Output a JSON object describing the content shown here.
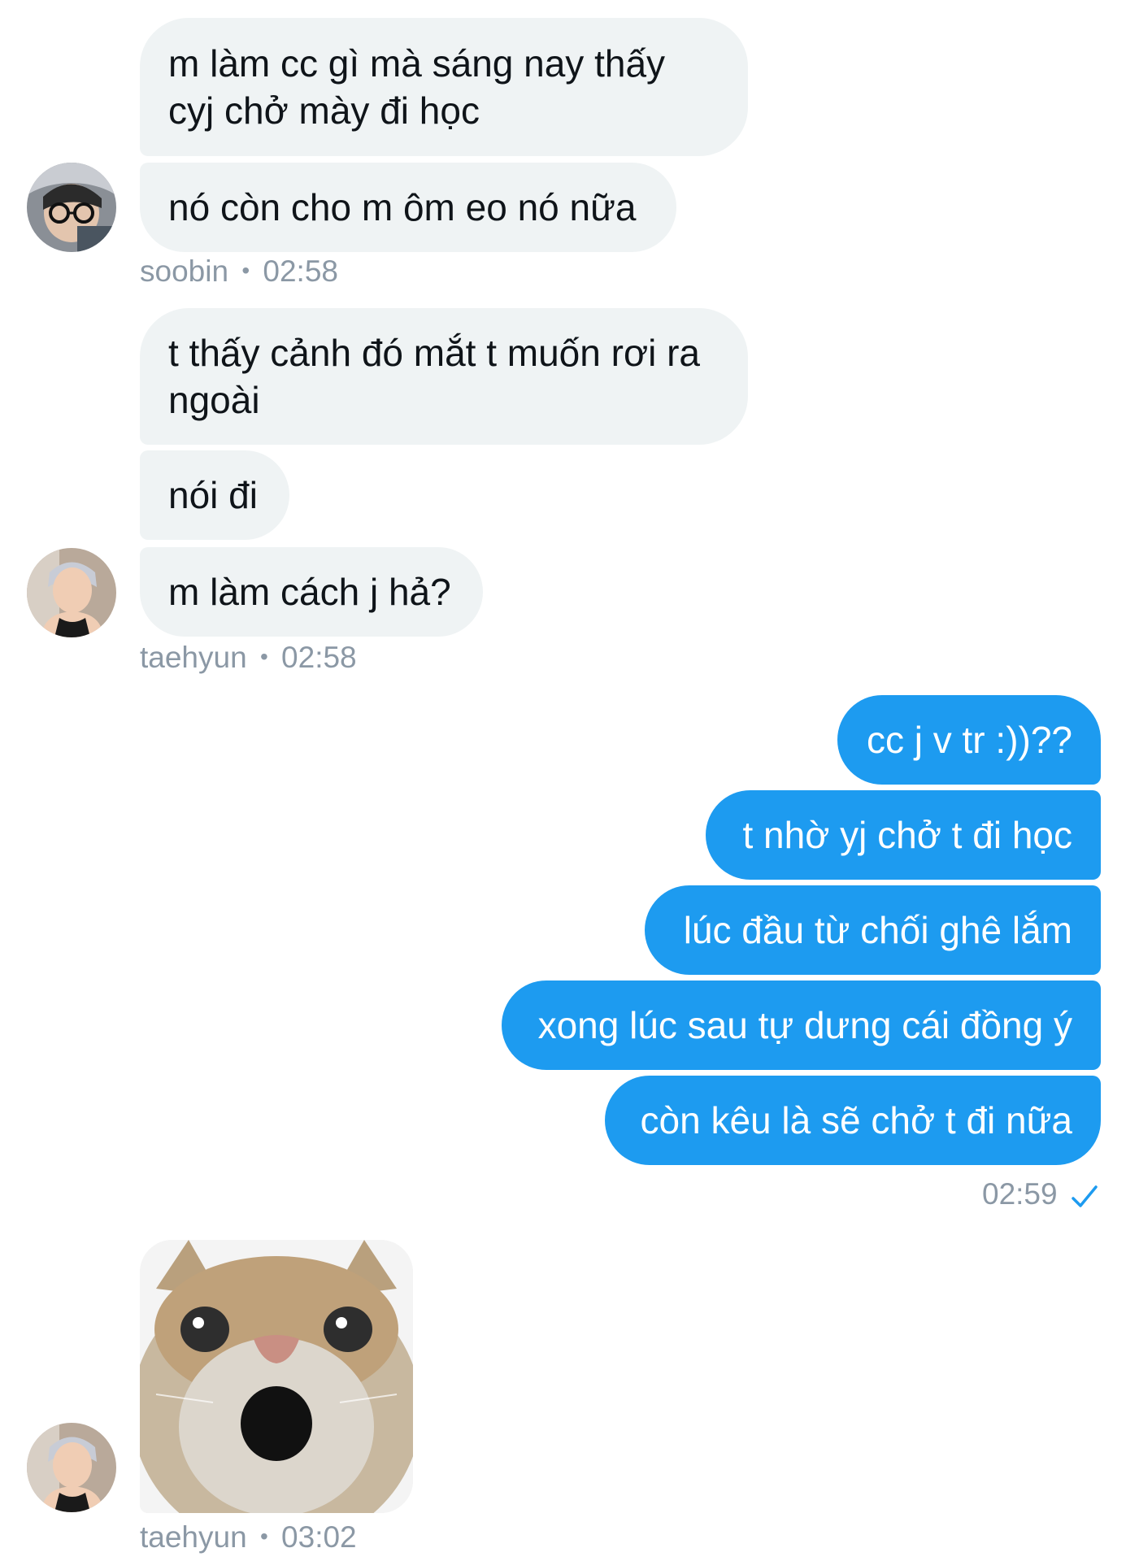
{
  "conversation": {
    "group1": {
      "messages": [
        "m làm cc gì mà sáng nay thấy",
        "cyj chở mày đi học",
        "nó còn cho m ôm eo nó nữa"
      ],
      "sender": "soobin",
      "separator": "•",
      "time": "02:58"
    },
    "group2": {
      "messages": [
        "t thấy cảnh đó mắt t muốn rơi ra",
        "ngoài",
        "nói đi",
        "m làm cách j hả?"
      ],
      "sender": "taehyun",
      "separator": "•",
      "time": "02:58"
    },
    "group3": {
      "messages": [
        "cc j v tr :))??",
        "t nhờ yj chở t đi học",
        "lúc đầu từ chối ghê lắm",
        "xong lúc sau tự dưng cái đồng ý",
        "còn kêu là sẽ chở t đi nữa"
      ],
      "time": "02:59",
      "status_icon": "check-icon"
    },
    "group4": {
      "image": "cat-meme-image",
      "sender": "taehyun",
      "separator": "•",
      "time": "03:02"
    }
  },
  "colors": {
    "incoming_bubble": "#eff3f4",
    "outgoing_bubble": "#1d9bf0",
    "meta_text": "#8b98a5",
    "check": "#1d9bf0"
  }
}
